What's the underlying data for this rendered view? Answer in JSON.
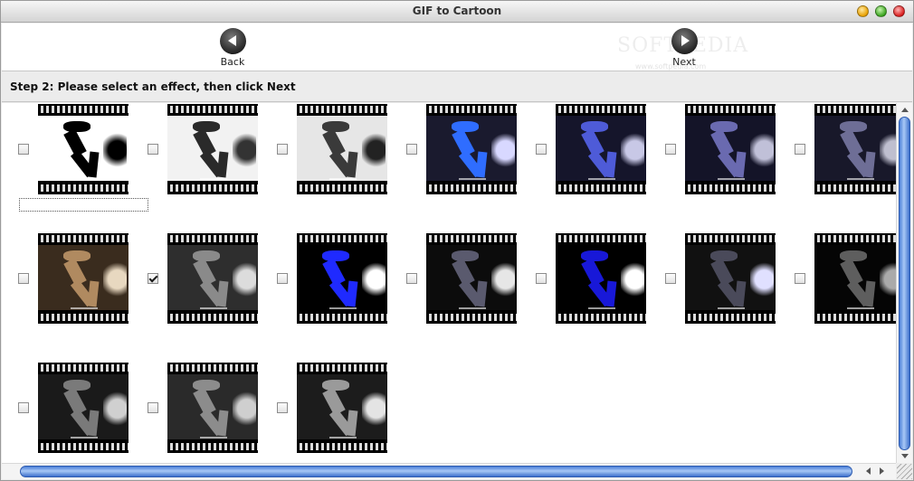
{
  "window": {
    "title": "GIF to Cartoon"
  },
  "toolbar": {
    "back_label": "Back",
    "next_label": "Next",
    "watermark": "SOFTPEDIA",
    "watermark_sub": "www.softpedia.com"
  },
  "step": {
    "text": "Step 2: Please select an effect, then click Next"
  },
  "effects": [
    {
      "row": 0,
      "col": 0,
      "checked": false,
      "style": "bw-solid"
    },
    {
      "row": 0,
      "col": 1,
      "checked": false,
      "style": "bw-dither"
    },
    {
      "row": 0,
      "col": 2,
      "checked": false,
      "style": "bw-sketch"
    },
    {
      "row": 0,
      "col": 3,
      "checked": false,
      "style": "blue-bright"
    },
    {
      "row": 0,
      "col": 4,
      "checked": false,
      "style": "blue-dither"
    },
    {
      "row": 0,
      "col": 5,
      "checked": false,
      "style": "purple-dark"
    },
    {
      "row": 0,
      "col": 6,
      "checked": false,
      "style": "grey-purple"
    },
    {
      "row": 1,
      "col": 0,
      "checked": false,
      "style": "sepia"
    },
    {
      "row": 1,
      "col": 1,
      "checked": true,
      "style": "grey-dither"
    },
    {
      "row": 1,
      "col": 2,
      "checked": false,
      "style": "blue-solid"
    },
    {
      "row": 1,
      "col": 3,
      "checked": false,
      "style": "dark-dither"
    },
    {
      "row": 1,
      "col": 4,
      "checked": false,
      "style": "navy-solid"
    },
    {
      "row": 1,
      "col": 5,
      "checked": false,
      "style": "dark-purple"
    },
    {
      "row": 1,
      "col": 6,
      "checked": false,
      "style": "dark-grey"
    },
    {
      "row": 2,
      "col": 0,
      "checked": false,
      "style": "grey-texture"
    },
    {
      "row": 2,
      "col": 1,
      "checked": false,
      "style": "grey-soft"
    },
    {
      "row": 2,
      "col": 2,
      "checked": false,
      "style": "grey-light"
    }
  ],
  "styles": {
    "bw-solid": {
      "bg": "#ffffff",
      "figure": "#000000",
      "crowd": "#000000"
    },
    "bw-dither": {
      "bg": "#f2f2f2",
      "figure": "#2a2a2a",
      "crowd": "#333333"
    },
    "bw-sketch": {
      "bg": "#e6e6e6",
      "figure": "#3a3a3a",
      "crowd": "#222222"
    },
    "blue-bright": {
      "bg": "#1a1a2e",
      "figure": "#2f6dff",
      "crowd": "#d8d8ff"
    },
    "blue-dither": {
      "bg": "#15152b",
      "figure": "#4e5bd8",
      "crowd": "#c8c8e6"
    },
    "purple-dark": {
      "bg": "#141428",
      "figure": "#6a6ab0",
      "crowd": "#c0c0d8"
    },
    "grey-purple": {
      "bg": "#18182a",
      "figure": "#6e6e96",
      "crowd": "#bfbfcf"
    },
    "sepia": {
      "bg": "#3a2c1e",
      "figure": "#b08a60",
      "crowd": "#e8d8c0"
    },
    "grey-dither": {
      "bg": "#2e2e2e",
      "figure": "#8a8a8a",
      "crowd": "#dcdcdc"
    },
    "blue-solid": {
      "bg": "#000000",
      "figure": "#1f2aff",
      "crowd": "#ffffff"
    },
    "dark-dither": {
      "bg": "#0c0c0c",
      "figure": "#5a5a6e",
      "crowd": "#e6e6e6"
    },
    "navy-solid": {
      "bg": "#000000",
      "figure": "#1818d8",
      "crowd": "#ffffff"
    },
    "dark-purple": {
      "bg": "#111111",
      "figure": "#4a4a5a",
      "crowd": "#e0e0ff"
    },
    "dark-grey": {
      "bg": "#050505",
      "figure": "#5e5e5e",
      "crowd": "#aaaaaa"
    },
    "grey-texture": {
      "bg": "#1a1a1a",
      "figure": "#7a7a7a",
      "crowd": "#d0d0d0"
    },
    "grey-soft": {
      "bg": "#2a2a2a",
      "figure": "#8c8c8c",
      "crowd": "#cfcfcf"
    },
    "grey-light": {
      "bg": "#1c1c1c",
      "figure": "#9a9a9a",
      "crowd": "#e4e4e4"
    }
  }
}
